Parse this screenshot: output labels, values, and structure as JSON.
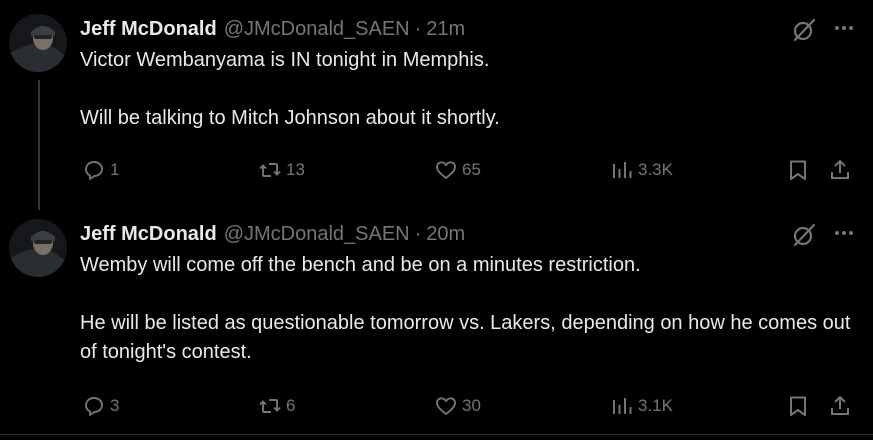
{
  "tweets": [
    {
      "author": "Jeff McDonald",
      "handle": "@JMcDonald_SAEN",
      "separator": "·",
      "time": "21m",
      "lines": [
        "Victor Wembanyama is IN tonight in Memphis.",
        "Will be talking to Mitch Johnson about it shortly."
      ],
      "stats": {
        "replies": "1",
        "reposts": "13",
        "likes": "65",
        "views": "3.3K"
      }
    },
    {
      "author": "Jeff McDonald",
      "handle": "@JMcDonald_SAEN",
      "separator": "·",
      "time": "20m",
      "lines": [
        "Wemby will come off the bench and be on a minutes restriction.",
        "He will be listed as questionable tomorrow vs. Lakers, depending on how he comes out of tonight's contest."
      ],
      "stats": {
        "replies": "3",
        "reposts": "6",
        "likes": "30",
        "views": "3.1K"
      }
    }
  ],
  "icons": {
    "reply": "reply-icon",
    "repost": "repost-icon",
    "like": "heart-icon",
    "views": "views-icon",
    "bookmark": "bookmark-icon",
    "share": "share-icon",
    "grok": "grok-icon",
    "more": "more-icon"
  },
  "colors": {
    "background": "#000000",
    "text": "#e7e9ea",
    "muted": "#71767b",
    "border": "#2f3336"
  }
}
